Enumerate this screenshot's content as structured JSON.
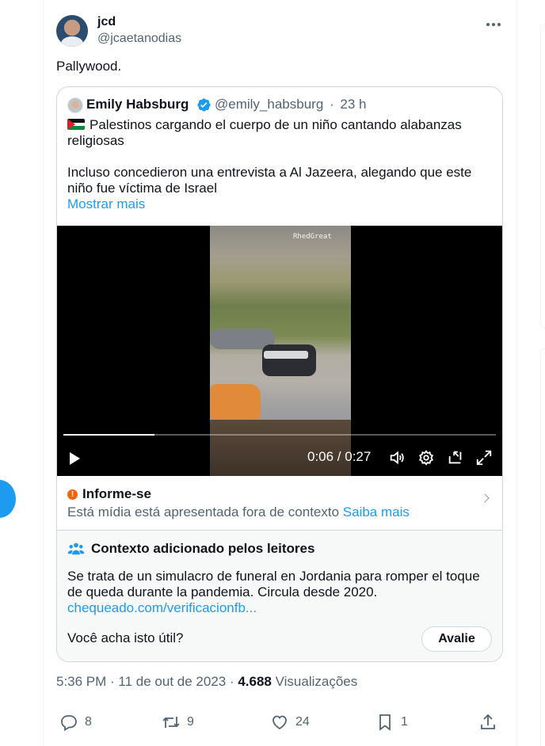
{
  "tweet": {
    "author_name": "jcd",
    "author_handle": "@jcaetanodias",
    "text": "Pallywood.",
    "timestamp": "5:36 PM · 11 de out de 2023 · ",
    "views_count": "4.688",
    "views_label": " Visualizações"
  },
  "quote": {
    "author_name": "Emily Habsburg",
    "author_handle": "@emily_habsburg",
    "separator": "·",
    "age": "23 h",
    "line1": "Palestinos cargando el cuerpo de un niño cantando alabanzas religiosas",
    "line2": "Incluso concedieron una entrevista a Al Jazeera, alegando que este niño fue víctima de Israel",
    "show_more": "Mostrar mais",
    "flag_icon": "palestine-flag-icon"
  },
  "video": {
    "watermark": "RhedGreat",
    "current_time": "0:06 / 0:27",
    "progress": 0.21,
    "icons": [
      "play-icon",
      "volume-icon",
      "settings-icon",
      "picture-in-picture-icon",
      "fullscreen-icon"
    ]
  },
  "informe": {
    "title": "Informe-se",
    "body": "Está mídia está apresentada fora de contexto ",
    "link": "Saiba mais"
  },
  "context": {
    "title": "Contexto adicionado pelos leitores",
    "body": "Se trata de un simulacro de funeral en Jordania para romper el toque de queda durante la pandemia. Circula desde 2020.",
    "link": "chequeado.com/verificacionfb...",
    "question": "Você acha isto útil?",
    "rate_button": "Avalie"
  },
  "actions": {
    "replies": "8",
    "retweets": "9",
    "likes": "24",
    "bookmarks": "1"
  },
  "colors": {
    "accent": "#1d9bf0",
    "text_secondary": "#536471",
    "warning": "#f4640c"
  }
}
